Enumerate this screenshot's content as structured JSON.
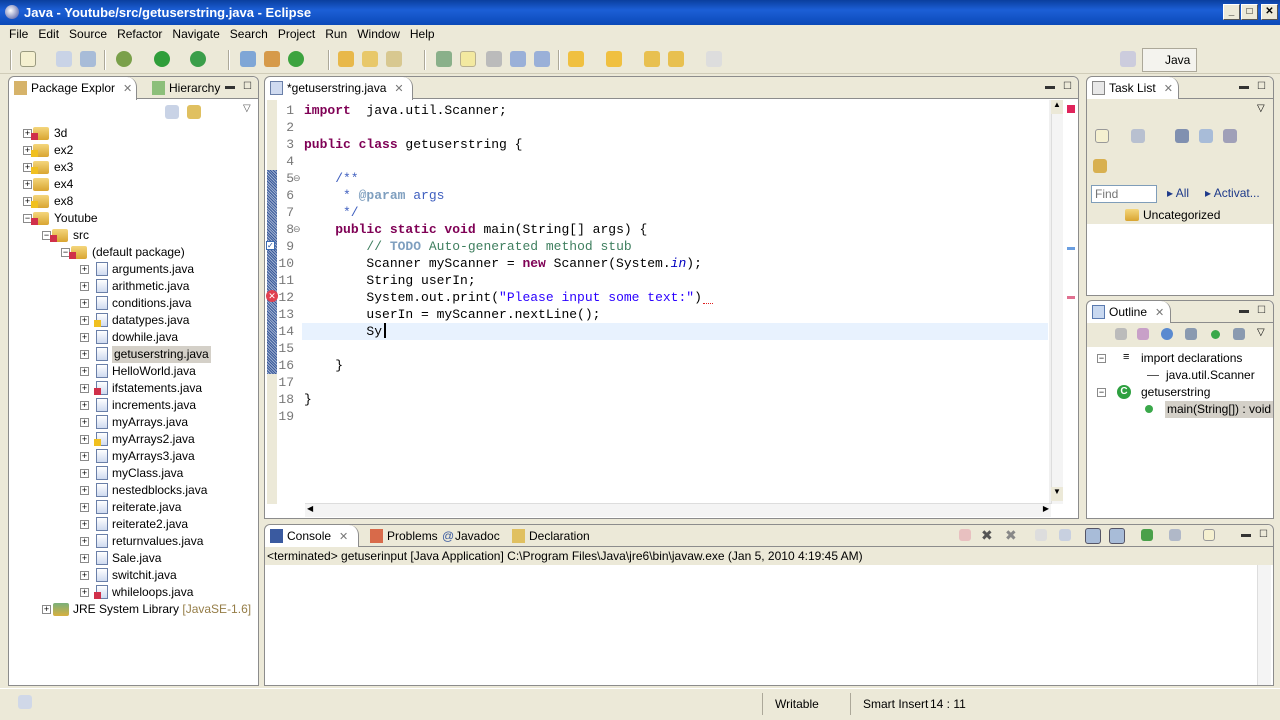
{
  "window": {
    "title": "Java - Youtube/src/getuserstring.java - Eclipse",
    "min": "_",
    "max": "□",
    "close": "✕"
  },
  "menu": [
    "File",
    "Edit",
    "Source",
    "Refactor",
    "Navigate",
    "Search",
    "Project",
    "Run",
    "Window",
    "Help"
  ],
  "perspective": {
    "label": "Java"
  },
  "left_panel": {
    "tabs": [
      "Package Explor",
      "Hierarchy"
    ],
    "tree": [
      {
        "label": "3d",
        "level": 0,
        "state": "+",
        "deco": "error"
      },
      {
        "label": "ex2",
        "level": 0,
        "state": "+",
        "deco": "warning"
      },
      {
        "label": "ex3",
        "level": 0,
        "state": "+",
        "deco": "warning"
      },
      {
        "label": "ex4",
        "level": 0,
        "state": "+",
        "deco": ""
      },
      {
        "label": "ex8",
        "level": 0,
        "state": "+",
        "deco": "warning"
      },
      {
        "label": "Youtube",
        "level": 0,
        "state": "-",
        "deco": "error"
      },
      {
        "label": "src",
        "level": 1,
        "state": "-",
        "deco": "error"
      },
      {
        "label": "(default package)",
        "level": 2,
        "state": "-",
        "deco": "error"
      },
      {
        "label": "arguments.java",
        "level": 3,
        "state": "+",
        "deco": ""
      },
      {
        "label": "arithmetic.java",
        "level": 3,
        "state": "+",
        "deco": ""
      },
      {
        "label": "conditions.java",
        "level": 3,
        "state": "+",
        "deco": ""
      },
      {
        "label": "datatypes.java",
        "level": 3,
        "state": "+",
        "deco": "warning"
      },
      {
        "label": "dowhile.java",
        "level": 3,
        "state": "+",
        "deco": ""
      },
      {
        "label": "getuserstring.java",
        "level": 3,
        "state": "+",
        "deco": "",
        "selected": true
      },
      {
        "label": "HelloWorld.java",
        "level": 3,
        "state": "+",
        "deco": ""
      },
      {
        "label": "ifstatements.java",
        "level": 3,
        "state": "+",
        "deco": "error"
      },
      {
        "label": "increments.java",
        "level": 3,
        "state": "+",
        "deco": ""
      },
      {
        "label": "myArrays.java",
        "level": 3,
        "state": "+",
        "deco": ""
      },
      {
        "label": "myArrays2.java",
        "level": 3,
        "state": "+",
        "deco": "warning"
      },
      {
        "label": "myArrays3.java",
        "level": 3,
        "state": "+",
        "deco": ""
      },
      {
        "label": "myClass.java",
        "level": 3,
        "state": "+",
        "deco": ""
      },
      {
        "label": "nestedblocks.java",
        "level": 3,
        "state": "+",
        "deco": ""
      },
      {
        "label": "reiterate.java",
        "level": 3,
        "state": "+",
        "deco": ""
      },
      {
        "label": "reiterate2.java",
        "level": 3,
        "state": "+",
        "deco": ""
      },
      {
        "label": "returnvalues.java",
        "level": 3,
        "state": "+",
        "deco": ""
      },
      {
        "label": "Sale.java",
        "level": 3,
        "state": "+",
        "deco": ""
      },
      {
        "label": "switchit.java",
        "level": 3,
        "state": "+",
        "deco": ""
      },
      {
        "label": "whileloops.java",
        "level": 3,
        "state": "+",
        "deco": "error"
      }
    ],
    "jre": {
      "label": "JRE System Library",
      "version": "[JavaSE-1.6]"
    }
  },
  "editor": {
    "tab": "*getuserstring.java",
    "lines": [
      [
        [
          "kw",
          "import"
        ],
        [
          "",
          "  java.util.Scanner;"
        ]
      ],
      [],
      [
        [
          "kw",
          "public class"
        ],
        [
          "",
          " getuserstring {"
        ]
      ],
      [],
      [
        [
          "cm",
          "    /**"
        ]
      ],
      [
        [
          "cm",
          "     * "
        ],
        [
          "tag",
          "@param"
        ],
        [
          "cm",
          " args"
        ]
      ],
      [
        [
          "cm",
          "     */"
        ]
      ],
      [
        [
          "",
          "    "
        ],
        [
          "kw",
          "public static void"
        ],
        [
          "",
          " main(String[] args) {"
        ]
      ],
      [
        [
          "",
          "        "
        ],
        [
          "cmt",
          "// "
        ],
        [
          "tag",
          "TODO"
        ],
        [
          "cmt",
          " Auto-generated method stub"
        ]
      ],
      [
        [
          "",
          "        Scanner myScanner = "
        ],
        [
          "kw",
          "new"
        ],
        [
          "",
          " Scanner(System."
        ],
        [
          "it",
          "in"
        ],
        [
          "",
          ");"
        ]
      ],
      [
        [
          "",
          "        String userIn;"
        ]
      ],
      [
        [
          "",
          "        System.out.print("
        ],
        [
          "str",
          "\"Please input some text:\""
        ],
        [
          "",
          ")"
        ]
      ],
      [
        [
          "",
          "        userIn = myScanner.nextLine();"
        ]
      ],
      [
        [
          "",
          "        Sy"
        ]
      ],
      [],
      [
        [
          "",
          "    }"
        ]
      ],
      [],
      [
        [
          "",
          "}"
        ]
      ],
      []
    ],
    "current_line": 14,
    "error_line": 12,
    "task_line": 9
  },
  "task_list": {
    "tab": "Task List",
    "find_placeholder": "Find",
    "all": "All",
    "activate": "Activat...",
    "category": "Uncategorized"
  },
  "outline": {
    "tab": "Outline",
    "items": [
      {
        "label": "import declarations"
      },
      {
        "label": "java.util.Scanner"
      },
      {
        "label": "getuserstring"
      },
      {
        "label": "main(String[]) : void",
        "selected": true
      }
    ]
  },
  "console": {
    "tabs": [
      "Console",
      "Problems",
      "Javadoc",
      "Declaration"
    ],
    "status": "<terminated> getuserinput [Java Application] C:\\Program Files\\Java\\jre6\\bin\\javaw.exe (Jan 5, 2010 4:19:45 AM)"
  },
  "statusbar": {
    "writable": "Writable",
    "insert": "Smart Insert",
    "position": "14 : 11"
  }
}
